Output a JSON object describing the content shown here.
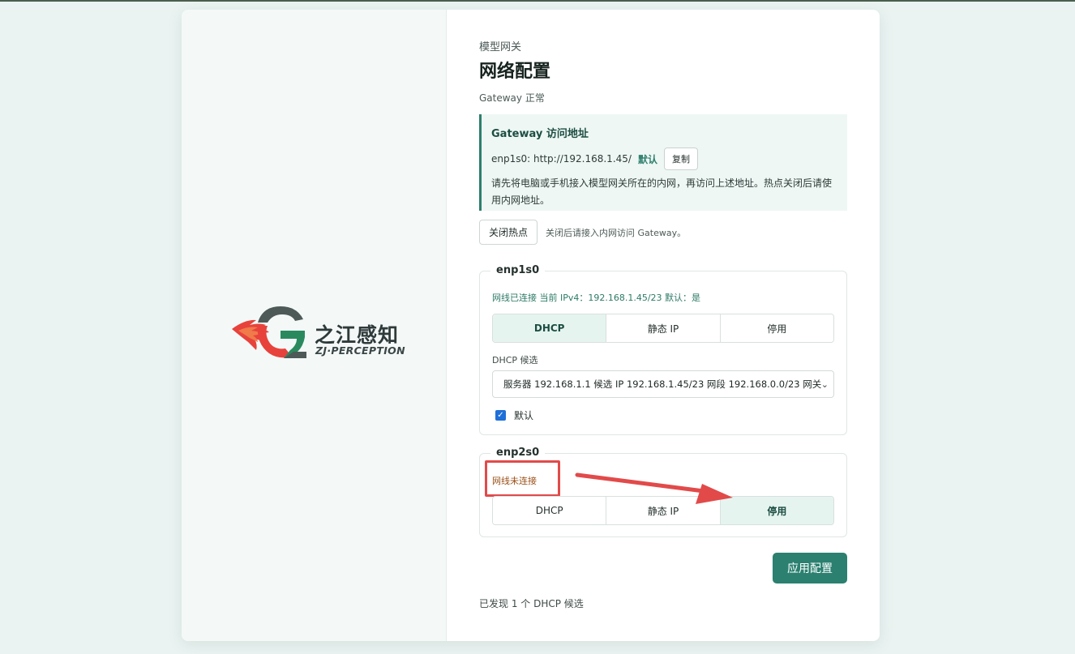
{
  "brand": {
    "name_cn": "之江感知",
    "name_en": "ZJ·PERCEPTION"
  },
  "header": {
    "eyebrow": "模型网关",
    "title": "网络配置",
    "status": "Gateway 正常"
  },
  "notice": {
    "title": "Gateway 访问地址",
    "address": "enp1s0: http://192.168.1.45/",
    "default_tag": "默认",
    "copy_label": "复制",
    "description": "请先将电脑或手机接入模型网关所在的内网，再访问上述地址。热点关闭后请使用内网地址。"
  },
  "hotspot": {
    "button_label": "关闭热点",
    "hint": "关闭后请接入内网访问 Gateway。"
  },
  "interfaces": [
    {
      "name": "enp1s0",
      "status": "网线已连接 当前 IPv4：192.168.1.45/23 默认：是",
      "modes": [
        "DHCP",
        "静态 IP",
        "停用"
      ],
      "active_mode": "DHCP",
      "candidate_label": "DHCP 候选",
      "candidate_value": "服务器 192.168.1.1 候选 IP 192.168.1.45/23 网段 192.168.0.0/23 网关",
      "default_label": "默认",
      "default_checked": true
    },
    {
      "name": "enp2s0",
      "status": "网线未连接",
      "modes": [
        "DHCP",
        "静态 IP",
        "停用"
      ],
      "active_mode": "停用"
    }
  ],
  "apply_label": "应用配置",
  "footer_note": "已发现 1 个 DHCP 候选",
  "colors": {
    "accent": "#2b8070",
    "annotation": "#e24a4a",
    "background": "#eaf3f1"
  }
}
